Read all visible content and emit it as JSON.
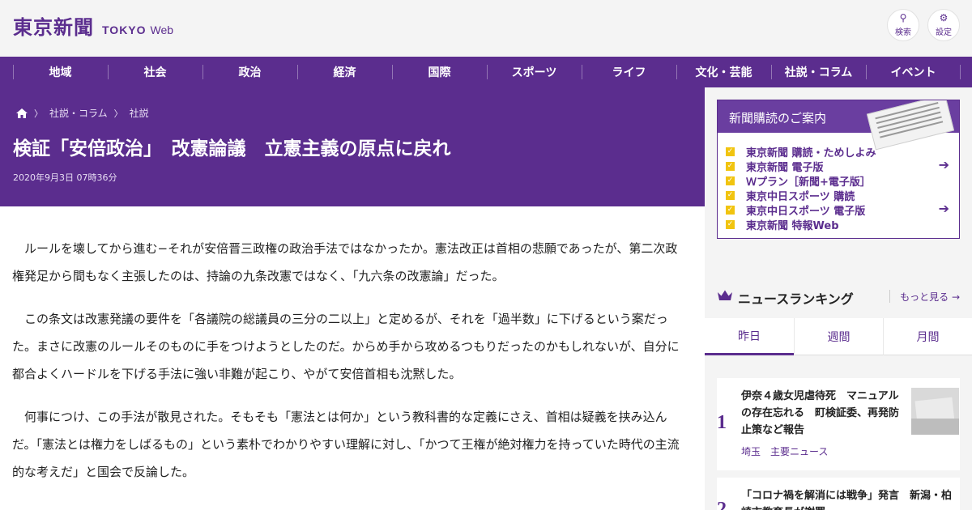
{
  "header": {
    "logo_kanji": "東京新聞",
    "logo_tokyo": "TOKYO",
    "logo_web": "Web",
    "search_label": "検索",
    "settings_label": "設定",
    "search_glyph": "⚲",
    "settings_glyph": "⚙"
  },
  "nav": {
    "items": [
      {
        "label": "地域"
      },
      {
        "label": "社会"
      },
      {
        "label": "政治"
      },
      {
        "label": "経済"
      },
      {
        "label": "国際"
      },
      {
        "label": "スポーツ"
      },
      {
        "label": "ライフ"
      },
      {
        "label": "文化・芸能"
      },
      {
        "label": "社説・コラム"
      },
      {
        "label": "イベント"
      }
    ]
  },
  "breadcrumb": {
    "sep": "〉",
    "items": [
      {
        "label": "社説・コラム"
      },
      {
        "label": "社説"
      }
    ]
  },
  "article": {
    "title": "検証「安倍政治」　改憲論議　立憲主義の原点に戻れ",
    "date": "2020年9月3日 07時36分",
    "paragraphs": [
      "ルールを壊してから進む−それが安倍晋三政権の政治手法ではなかったか。憲法改正は首相の悲願であったが、第二次政権発足から間もなく主張したのは、持論の九条改憲ではなく、「九六条の改憲論」だった。",
      "この条文は改憲発議の要件を「各議院の総議員の三分の二以上」と定めるが、それを「過半数」に下げるという案だった。まさに改憲のルールそのものに手をつけようとしたのだ。からめ手から攻めるつもりだったのかもしれないが、自分に都合よくハードルを下げる手法に強い非難が起こり、やがて安倍首相も沈黙した。",
      "何事につけ、この手法が散見された。そもそも「憲法とは何か」という教科書的な定義にさえ、首相は疑義を挟み込んだ。「憲法とは権力をしばるもの」という素朴でわかりやすい理解に対し、「かつて王権が絶対権力を持っていた時代の主流的な考えだ」と国会で反論した。"
    ]
  },
  "subscription": {
    "title": "新聞購読のご案内",
    "check_glyph": "✓",
    "login_glyph": "➔",
    "items": [
      {
        "label": "東京新聞 購読・ためしよみ",
        "login": false
      },
      {
        "label": "東京新聞 電子版",
        "login": true
      },
      {
        "label": "Ｗプラン［新聞+電子版］",
        "login": false
      },
      {
        "label": "東京中日スポーツ 購読",
        "login": false
      },
      {
        "label": "東京中日スポーツ 電子版",
        "login": true
      },
      {
        "label": "東京新聞 特報Web",
        "login": false
      }
    ]
  },
  "ranking": {
    "title": "ニュースランキング",
    "more_label": "もっと見る",
    "more_arrow": "→",
    "tabs": [
      {
        "label": "昨日",
        "active": true
      },
      {
        "label": "週間",
        "active": false
      },
      {
        "label": "月間",
        "active": false
      }
    ],
    "items": [
      {
        "rank": "1",
        "title": "伊奈４歳女児虐待死　マニュアルの存在忘れる　町検証委、再発防止策など報告",
        "category": "埼玉　主要ニュース",
        "has_thumb": true
      },
      {
        "rank": "2",
        "title": "「コロナ禍を解消には戦争」発言　新潟・柏崎市教育長が謝罪",
        "category": "",
        "has_thumb": false
      }
    ]
  },
  "colors": {
    "brand_purple": "#5b2d8e",
    "checkbox_yellow": "#f1c40f",
    "header_bg": "#f4f4f4"
  }
}
